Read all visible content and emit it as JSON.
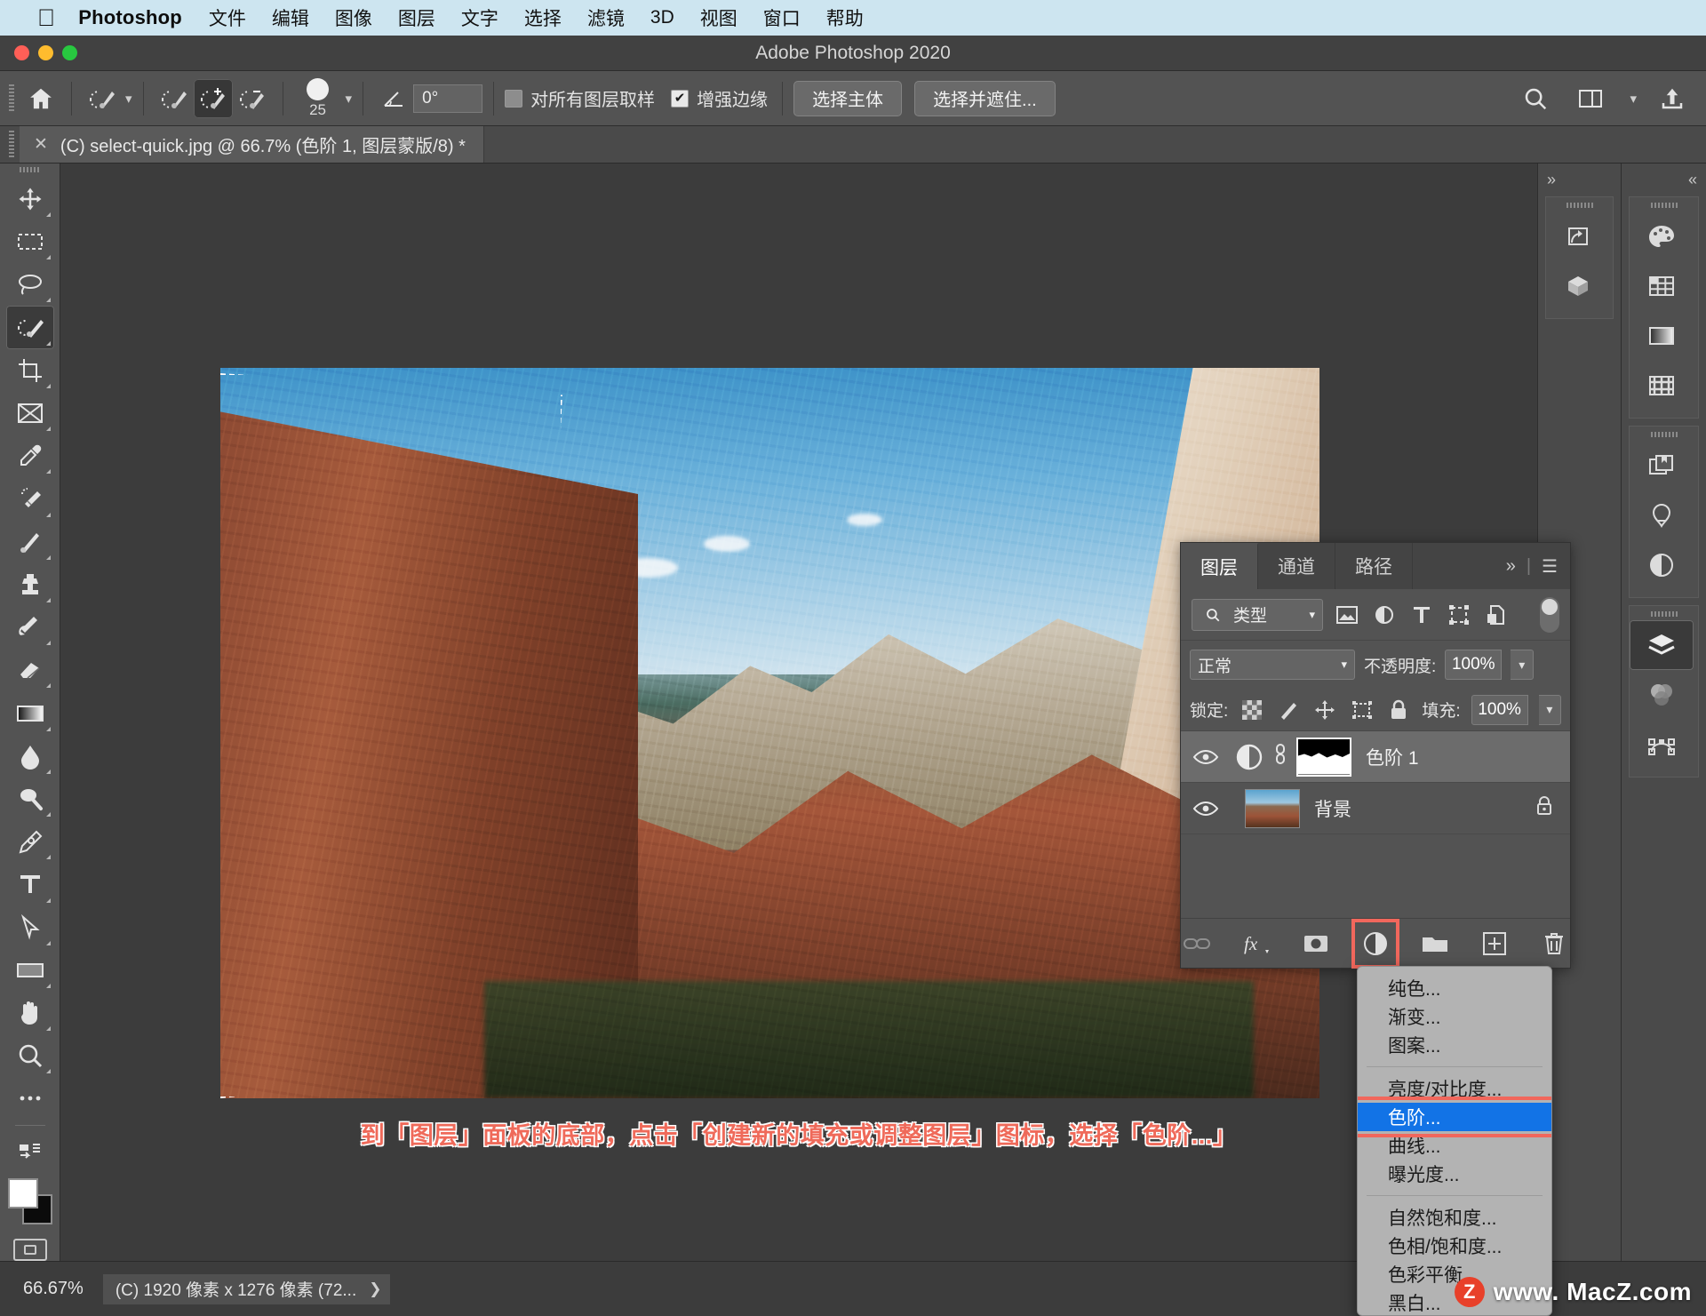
{
  "macbar": {
    "apple_icon": "apple-logo-icon",
    "app_name": "Photoshop",
    "menus": [
      "文件",
      "编辑",
      "图像",
      "图层",
      "文字",
      "选择",
      "滤镜",
      "3D",
      "视图",
      "窗口",
      "帮助"
    ]
  },
  "window": {
    "title": "Adobe Photoshop 2020"
  },
  "options_bar": {
    "home_icon": "home-icon",
    "tool_preset_icon": "quick-selection-tool-icon",
    "mode_new_icon": "selection-new-icon",
    "mode_add_icon": "selection-add-icon",
    "mode_subtract_icon": "selection-subtract-icon",
    "brush_size": "25",
    "angle_icon": "angle-icon",
    "angle_value": "0°",
    "sample_all_layers": {
      "label": "对所有图层取样",
      "checked": false
    },
    "enhance_edge": {
      "label": "增强边缘",
      "checked": true
    },
    "select_subject": "选择主体",
    "select_and_mask": "选择并遮住...",
    "search_icon": "search-icon",
    "arrange_icon": "arrange-documents-icon",
    "share_icon": "share-icon"
  },
  "document_tab": {
    "close_icon": "close-icon",
    "title": "(C) select-quick.jpg @ 66.7% (色阶 1, 图层蒙版/8) *"
  },
  "tools": [
    {
      "name": "move-tool",
      "label": "移动工具"
    },
    {
      "name": "marquee-tool",
      "label": "矩形选框工具"
    },
    {
      "name": "lasso-tool",
      "label": "套索工具"
    },
    {
      "name": "quick-selection-tool",
      "label": "快速选择工具",
      "active": true
    },
    {
      "name": "crop-tool",
      "label": "裁剪工具"
    },
    {
      "name": "frame-tool",
      "label": "画框工具"
    },
    {
      "name": "eyedropper-tool",
      "label": "吸管工具"
    },
    {
      "name": "healing-brush-tool",
      "label": "修复画笔工具"
    },
    {
      "name": "brush-tool",
      "label": "画笔工具"
    },
    {
      "name": "clone-stamp-tool",
      "label": "仿制图章工具"
    },
    {
      "name": "history-brush-tool",
      "label": "历史记录画笔工具"
    },
    {
      "name": "eraser-tool",
      "label": "橡皮擦工具"
    },
    {
      "name": "gradient-tool",
      "label": "渐变工具"
    },
    {
      "name": "blur-tool",
      "label": "模糊工具"
    },
    {
      "name": "dodge-tool",
      "label": "减淡工具"
    },
    {
      "name": "pen-tool",
      "label": "钢笔工具"
    },
    {
      "name": "type-tool",
      "label": "横排文字工具"
    },
    {
      "name": "path-selection-tool",
      "label": "路径选择工具"
    },
    {
      "name": "rectangle-tool",
      "label": "矩形工具"
    },
    {
      "name": "hand-tool",
      "label": "抓手工具"
    },
    {
      "name": "zoom-tool",
      "label": "缩放工具"
    },
    {
      "name": "more-tools",
      "label": "..."
    }
  ],
  "color_swatches": {
    "foreground": "#ffffff",
    "background": "#0b0b0b",
    "quick_mask_icon": "quick-mask-icon"
  },
  "right_rail_a": [
    {
      "name": "color-panel-icon"
    },
    {
      "name": "swatches-panel-icon"
    },
    {
      "name": "gradients-panel-icon"
    },
    {
      "name": "patterns-panel-icon"
    },
    {
      "name": "libraries-panel-icon"
    },
    {
      "name": "adjustments-panel-icon"
    },
    {
      "name": "properties-panel-icon"
    }
  ],
  "right_rail_b": [
    {
      "name": "history-panel-icon"
    },
    {
      "name": "3d-panel-icon"
    }
  ],
  "right_rail_c": [
    {
      "name": "layers-panel-icon",
      "active": true
    },
    {
      "name": "channels-panel-icon"
    },
    {
      "name": "paths-panel-icon"
    }
  ],
  "layers_panel": {
    "tabs": [
      {
        "label": "图层",
        "active": true
      },
      {
        "label": "通道",
        "active": false
      },
      {
        "label": "路径",
        "active": false
      }
    ],
    "expand_icon": "chevron-double-right-icon",
    "menu_icon": "panel-menu-icon",
    "filter": {
      "search_icon": "search-icon",
      "type_label": "类型",
      "chevron_icon": "chevron-down-icon",
      "icons": [
        "filter-pixel-icon",
        "filter-adjustment-icon",
        "filter-type-icon",
        "filter-shape-icon",
        "filter-smart-object-icon"
      ],
      "toggle_name": "filter-enable-toggle"
    },
    "blend_mode": "正常",
    "opacity_label": "不透明度:",
    "opacity_value": "100%",
    "lock_label": "锁定:",
    "lock_icons": [
      "lock-transparent-pixels-icon",
      "lock-image-pixels-icon",
      "lock-position-icon",
      "lock-artboard-icon",
      "lock-all-icon"
    ],
    "fill_label": "填充:",
    "fill_value": "100%",
    "layers": [
      {
        "name": "色阶 1",
        "visible": true,
        "selected": true,
        "kind": "adjustment",
        "eye_icon": "eye-icon",
        "adjustment_icon": "levels-adjustment-icon",
        "link_icon": "mask-link-icon",
        "mask_icon": "layer-mask-thumbnail"
      },
      {
        "name": "背景",
        "visible": true,
        "selected": false,
        "kind": "image",
        "eye_icon": "eye-icon",
        "lock_icon": "lock-icon"
      }
    ],
    "bottom_buttons": [
      {
        "name": "link-layers-button",
        "icon": "link-icon",
        "disabled": true
      },
      {
        "name": "layer-style-button",
        "icon": "fx-icon"
      },
      {
        "name": "add-layer-mask-button",
        "icon": "mask-icon"
      },
      {
        "name": "new-adjustment-layer-button",
        "icon": "half-circle-icon",
        "highlighted": true
      },
      {
        "name": "new-group-button",
        "icon": "folder-icon"
      },
      {
        "name": "new-layer-button",
        "icon": "plus-square-icon"
      },
      {
        "name": "delete-layer-button",
        "icon": "trash-icon"
      }
    ]
  },
  "adjustment_menu": {
    "groups": [
      [
        "纯色...",
        "渐变...",
        "图案..."
      ],
      [
        "亮度/对比度...",
        "色阶...",
        "曲线...",
        "曝光度..."
      ],
      [
        "自然饱和度...",
        "色相/饱和度...",
        "色彩平衡...",
        "黑白..."
      ]
    ],
    "highlighted": "色阶..."
  },
  "annotation": {
    "text": "到「图层」面板的底部，点击「创建新的填充或调整图层」图标，选择「色阶...」",
    "color": "#ef6a5a"
  },
  "status_bar": {
    "zoom": "66.67%",
    "doc_info": "(C) 1920 像素 x 1276 像素 (72...",
    "arrow_icon": "chevron-right-icon"
  },
  "watermark": {
    "badge": "Z",
    "text": "www. MacZ.com"
  },
  "accent_colors": {
    "menu_highlight": "#1273e6",
    "annotation_red": "#ef6a5a",
    "callout_box": "#f1675c"
  }
}
